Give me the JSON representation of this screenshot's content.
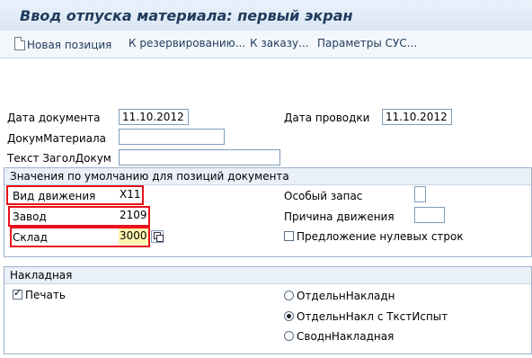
{
  "header": {
    "title": "Ввод отпуска материала: первый экран"
  },
  "toolbar": {
    "items": [
      {
        "label": "Новая позиция"
      },
      {
        "label": "К резервированию..."
      },
      {
        "label": "К заказу..."
      },
      {
        "label": "Параметры СУС..."
      }
    ]
  },
  "doc": {
    "doc_date_label": "Дата документа",
    "doc_date": "11.10.2012",
    "posting_date_label": "Дата проводки",
    "posting_date": "11.10.2012",
    "material_doc_label": "ДокумМатериала",
    "material_doc": "",
    "header_text_label": "Текст ЗаголДокум",
    "header_text": ""
  },
  "defaults": {
    "title": "Значения по умолчанию для позиций документа",
    "movement_type_label": "Вид движения",
    "movement_type": "X11",
    "plant_label": "Завод",
    "plant": "2109",
    "storage_label": "Склад",
    "storage": "3000",
    "special_stock_label": "Особый запас",
    "special_stock": "",
    "reason_label": "Причина движения",
    "reason": "",
    "zero_lines_label": "Предложение нулевых строк",
    "zero_lines_checked": false
  },
  "slip": {
    "title": "Накладная",
    "print_label": "Печать",
    "print_checked": true,
    "options": [
      {
        "label": "ОтдельнНакладн",
        "selected": false
      },
      {
        "label": "ОтдельнНакл с ТкстИспыт",
        "selected": true
      },
      {
        "label": "СводнНакладная",
        "selected": false
      }
    ]
  },
  "colors": {
    "highlight": "#e8101a",
    "accent": "#1f3a5c"
  }
}
